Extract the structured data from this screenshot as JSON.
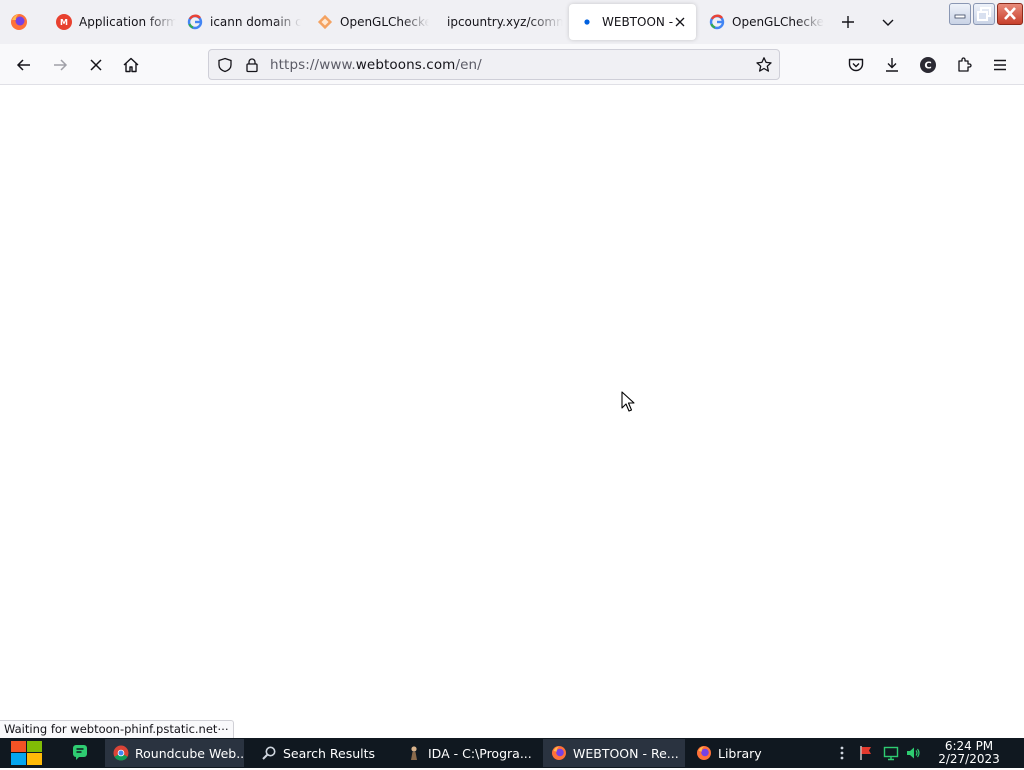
{
  "browser": {
    "tabs": [
      {
        "label": "Application form",
        "icon": "mangoboard-icon",
        "active": false
      },
      {
        "label": "icann domain cr",
        "icon": "google-icon",
        "active": false
      },
      {
        "label": "OpenGLChecke",
        "icon": "openglchecker-icon",
        "active": false
      },
      {
        "label": "ipcountry.xyz/comm",
        "icon": "blank-page-icon",
        "active": false
      },
      {
        "label": "WEBTOON - ",
        "icon": "loading-dot-icon",
        "active": true
      },
      {
        "label": "OpenGLChecke",
        "icon": "google-icon",
        "active": false
      }
    ],
    "url": {
      "scheme": "https://www.",
      "host": "webtoons.com",
      "path": "/en/"
    },
    "status_text": "Waiting for webtoon-phinf.pstatic.net⋯",
    "colors": {
      "accent": "#0060df",
      "tabstrip": "#f0f0f4",
      "navbar": "#f9f9fb"
    }
  },
  "taskbar": {
    "items": [
      {
        "label": "Roundcube Web...",
        "icon": "chrome-icon",
        "active": true
      },
      {
        "label": "Search Results",
        "icon": "search-icon",
        "active": false
      },
      {
        "label": "IDA - C:\\Progra...",
        "icon": "ida-icon",
        "active": false
      },
      {
        "label": "WEBTOON - Re...",
        "icon": "firefox-icon",
        "active": true
      },
      {
        "label": "Library",
        "icon": "firefox-icon",
        "active": false
      }
    ],
    "clock": {
      "time": "6:24 PM",
      "date": "2/27/2023"
    }
  }
}
